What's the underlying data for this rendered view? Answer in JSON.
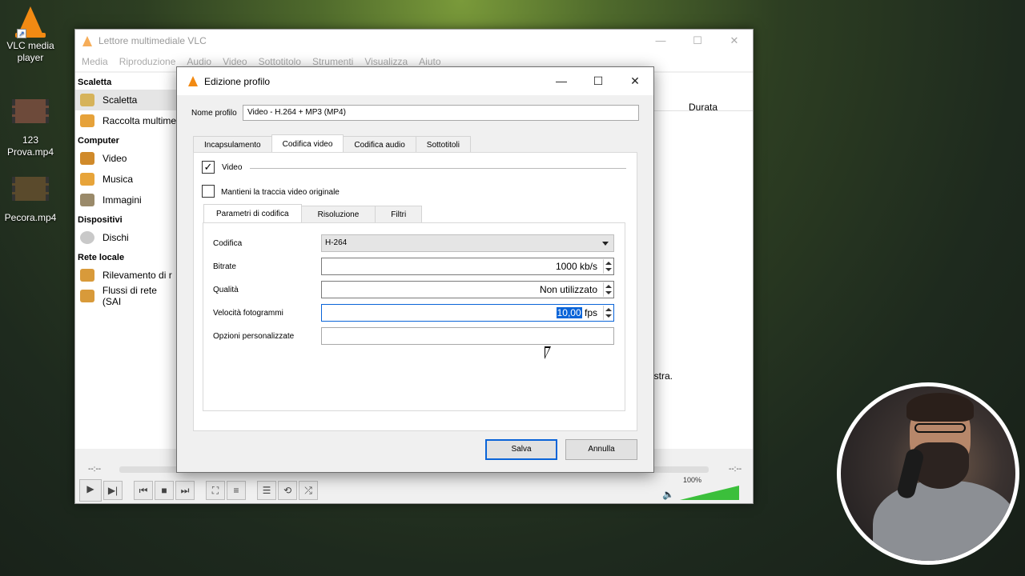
{
  "desktop": {
    "icons": [
      {
        "label_line1": "VLC media",
        "label_line2": "player"
      },
      {
        "label_line1": "123",
        "label_line2": "Prova.mp4"
      },
      {
        "label_line1": "Pecora.mp4",
        "label_line2": ""
      }
    ]
  },
  "vlc": {
    "title": "Lettore multimediale VLC",
    "menu": [
      "Media",
      "Riproduzione",
      "Audio",
      "Video",
      "Sottotitolo",
      "Strumenti",
      "Visualizza",
      "Aiuto"
    ],
    "sidebar": {
      "sections": [
        {
          "header": "Scaletta",
          "items": [
            "Scaletta",
            "Raccolta multime"
          ]
        },
        {
          "header": "Computer",
          "items": [
            "Video",
            "Musica",
            "Immagini"
          ]
        },
        {
          "header": "Dispositivi",
          "items": [
            "Dischi"
          ]
        },
        {
          "header": "Rete locale",
          "items": [
            "Rilevamento di r",
            "Flussi di rete (SAI"
          ]
        }
      ]
    },
    "right_column_header": "Durata",
    "right_text": "istra.",
    "time_left": "--:--",
    "time_right": "--:--",
    "volume": "100%"
  },
  "dialog": {
    "title": "Edizione profilo",
    "profile_name_label": "Nome profilo",
    "profile_name_value": "Video - H.264 + MP3 (MP4)",
    "tabs": [
      "Incapsulamento",
      "Codifica video",
      "Codifica audio",
      "Sottotitoli"
    ],
    "video_checkbox_label": "Video",
    "keep_original_label": "Mantieni la traccia video originale",
    "subtabs": [
      "Parametri di codifica",
      "Risoluzione",
      "Filtri"
    ],
    "codec_label": "Codifica",
    "codec_value": "H-264",
    "bitrate_label": "Bitrate",
    "bitrate_value": "1000 kb/s",
    "quality_label": "Qualità",
    "quality_value": "Non utilizzato",
    "fps_label": "Velocità fotogrammi",
    "fps_value": "10,00",
    "fps_unit": "fps",
    "custom_label": "Opzioni personalizzate",
    "custom_value": "",
    "save": "Salva",
    "cancel": "Annulla"
  }
}
